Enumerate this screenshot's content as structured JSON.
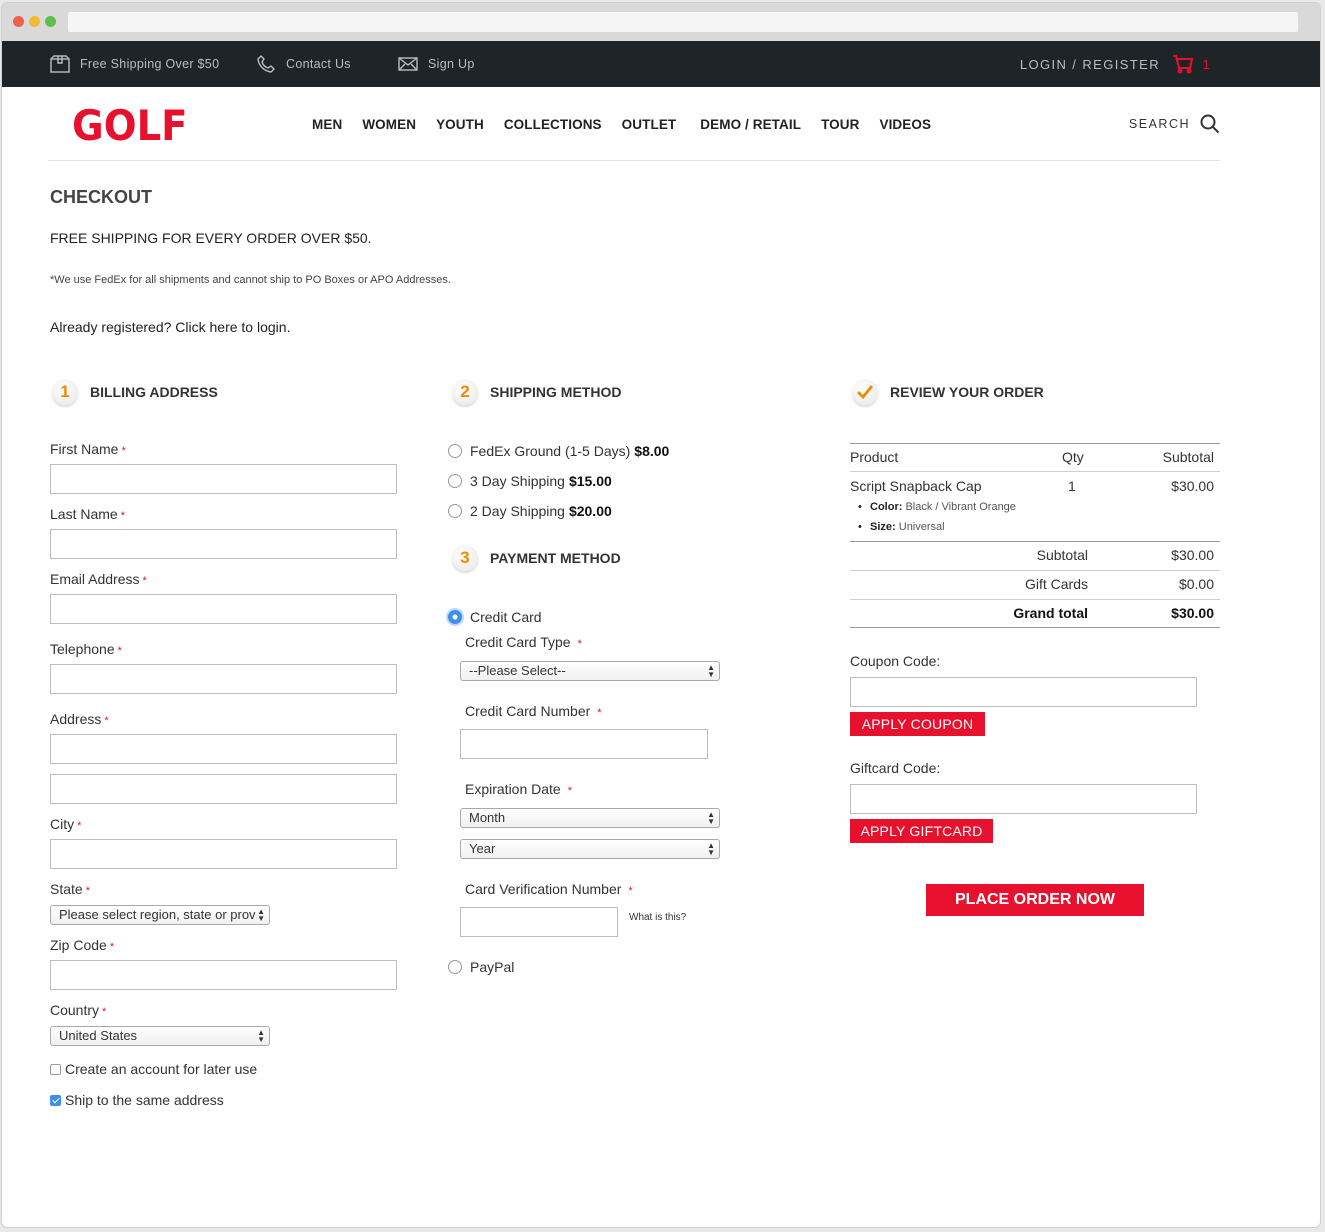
{
  "topbar": {
    "free_shipping": "Free Shipping Over $50",
    "contact": "Contact Us",
    "signup": "Sign Up",
    "login": "LOGIN / REGISTER",
    "cart_count": "1"
  },
  "header": {
    "logo": "GOLF",
    "nav": [
      "MEN",
      "WOMEN",
      "YOUTH",
      "COLLECTIONS",
      "OUTLET",
      "DEMO / RETAIL",
      "TOUR",
      "VIDEOS"
    ],
    "search": "SEARCH"
  },
  "page": {
    "title": "CHECKOUT",
    "free_shipping": "FREE SHIPPING FOR EVERY ORDER OVER $50.",
    "fedex_note": "*We use FedEx for all shipments and cannot ship to PO Boxes or APO Addresses.",
    "already": "Already registered? Click here to login."
  },
  "billing": {
    "step": "1",
    "title": "BILLING ADDRESS",
    "first_name": "First Name",
    "last_name": "Last Name",
    "email": "Email Address",
    "telephone": "Telephone",
    "address": "Address",
    "city": "City",
    "state": "State",
    "state_value": "Please select region, state or province",
    "zip": "Zip Code",
    "country": "Country",
    "country_value": "United States",
    "create_account": "Create an account for later use",
    "ship_same": "Ship to the same address",
    "req": "*"
  },
  "shipping": {
    "step": "2",
    "title": "SHIPPING METHOD",
    "options": [
      {
        "label": "FedEx Ground (1-5 Days)",
        "price": "$8.00"
      },
      {
        "label": "3 Day Shipping",
        "price": "$15.00"
      },
      {
        "label": "2 Day Shipping",
        "price": "$20.00"
      }
    ]
  },
  "payment": {
    "step": "3",
    "title": "PAYMENT METHOD",
    "credit_card": "Credit Card",
    "card_type": "Credit Card Type",
    "card_type_value": "--Please Select--",
    "card_number": "Credit Card Number",
    "expiration": "Expiration Date",
    "month": "Month",
    "year": "Year",
    "cvv": "Card Verification Number",
    "what_is_this": "What is this?",
    "paypal": "PayPal"
  },
  "review": {
    "title": "REVIEW YOUR ORDER",
    "col_product": "Product",
    "col_qty": "Qty",
    "col_subtotal": "Subtotal",
    "item": {
      "name": "Script Snapback Cap",
      "qty": "1",
      "subtotal": "$30.00",
      "color_label": "Color:",
      "color_value": "Black / Vibrant Orange",
      "size_label": "Size:",
      "size_value": "Universal"
    },
    "subtotal_label": "Subtotal",
    "subtotal_value": "$30.00",
    "giftcards_label": "Gift Cards",
    "giftcards_value": "$0.00",
    "grand_label": "Grand total",
    "grand_value": "$30.00",
    "coupon_label": "Coupon Code:",
    "apply_coupon": "APPLY COUPON",
    "giftcard_label": "Giftcard Code:",
    "apply_giftcard": "APPLY GIFTCARD",
    "place_order": "PLACE ORDER NOW"
  },
  "colors": {
    "brand_red": "#e8112d",
    "topbar_bg": "#1f2429",
    "step_orange": "#f08a00"
  }
}
